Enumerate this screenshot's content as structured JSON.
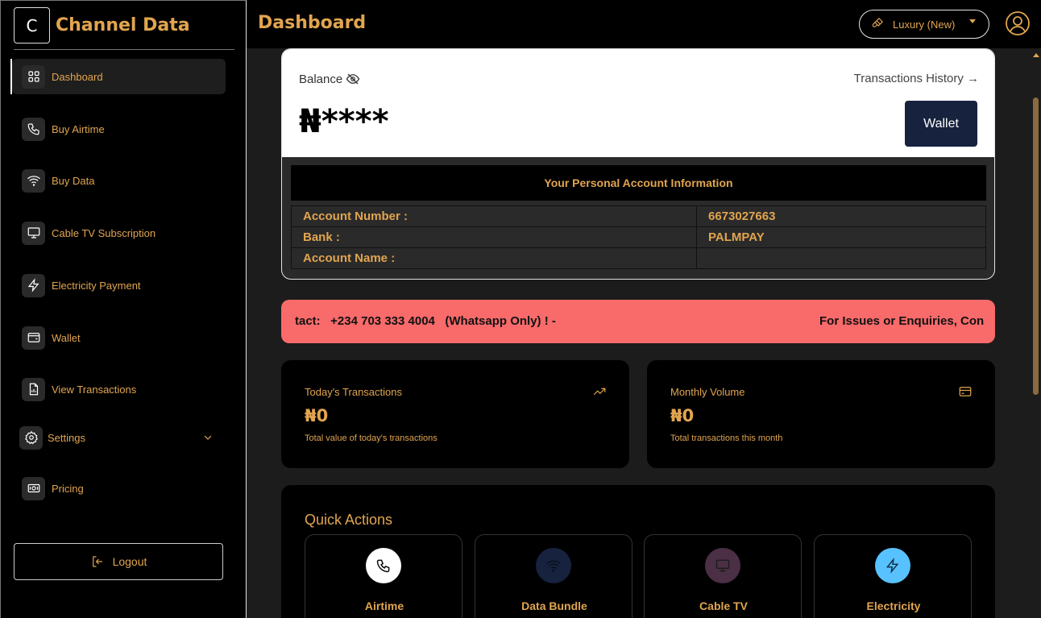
{
  "brand": {
    "letter": "C",
    "name": "Channel Data"
  },
  "header": {
    "title": "Dashboard",
    "theme_label": "Luxury (New)"
  },
  "sidebar": {
    "items": [
      {
        "label": "Dashboard",
        "icon": "grid-icon"
      },
      {
        "label": "Buy Airtime",
        "icon": "phone-icon"
      },
      {
        "label": "Buy Data",
        "icon": "wifi-icon"
      },
      {
        "label": "Cable TV Subscription",
        "icon": "tv-icon"
      },
      {
        "label": "Electricity Payment",
        "icon": "lightning-icon"
      },
      {
        "label": "Wallet",
        "icon": "wallet-icon"
      },
      {
        "label": "View Transactions",
        "icon": "file-chart-icon"
      },
      {
        "label": "Settings",
        "icon": "gear-icon"
      },
      {
        "label": "Pricing",
        "icon": "money-icon"
      }
    ],
    "logout_label": "Logout"
  },
  "balance": {
    "label": "Balance",
    "value": "₦****",
    "history_link": "Transactions History →",
    "wallet_button": "Wallet"
  },
  "account": {
    "heading": "Your Personal Account Information",
    "rows": [
      {
        "key": "Account Number :",
        "value": "6673027663"
      },
      {
        "key": "Bank :",
        "value": "PALMPAY"
      },
      {
        "key": "Account Name :",
        "value": ""
      }
    ]
  },
  "marquee": {
    "part1": "tact:   +234 703 333 4004   (Whatsapp Only) ! -",
    "part2": "For Issues or Enquiries, Con"
  },
  "stats": [
    {
      "title": "Today's Transactions",
      "value": "₦0",
      "desc": "Total value of today's transactions",
      "icon": "trending-up-icon"
    },
    {
      "title": "Monthly Volume",
      "value": "₦0",
      "desc": "Total transactions this month",
      "icon": "card-icon"
    }
  ],
  "quick_actions": {
    "title": "Quick Actions",
    "items": [
      {
        "label": "Airtime",
        "icon": "phone-icon",
        "bg": "#ffffff",
        "fg": "#000000"
      },
      {
        "label": "Data Bundle",
        "icon": "wifi-icon",
        "bg": "#16223e",
        "fg": "#0e1526"
      },
      {
        "label": "Cable TV",
        "icon": "tv-icon",
        "bg": "#4a2f45",
        "fg": "#1c1c1c"
      },
      {
        "label": "Electricity",
        "icon": "lightning-icon",
        "bg": "#58c1ff",
        "fg": "#0b2d42"
      }
    ]
  },
  "colors": {
    "accent": "#e1a54f",
    "marquee_bg": "#f96a6a",
    "wallet_button": "#16223e"
  }
}
